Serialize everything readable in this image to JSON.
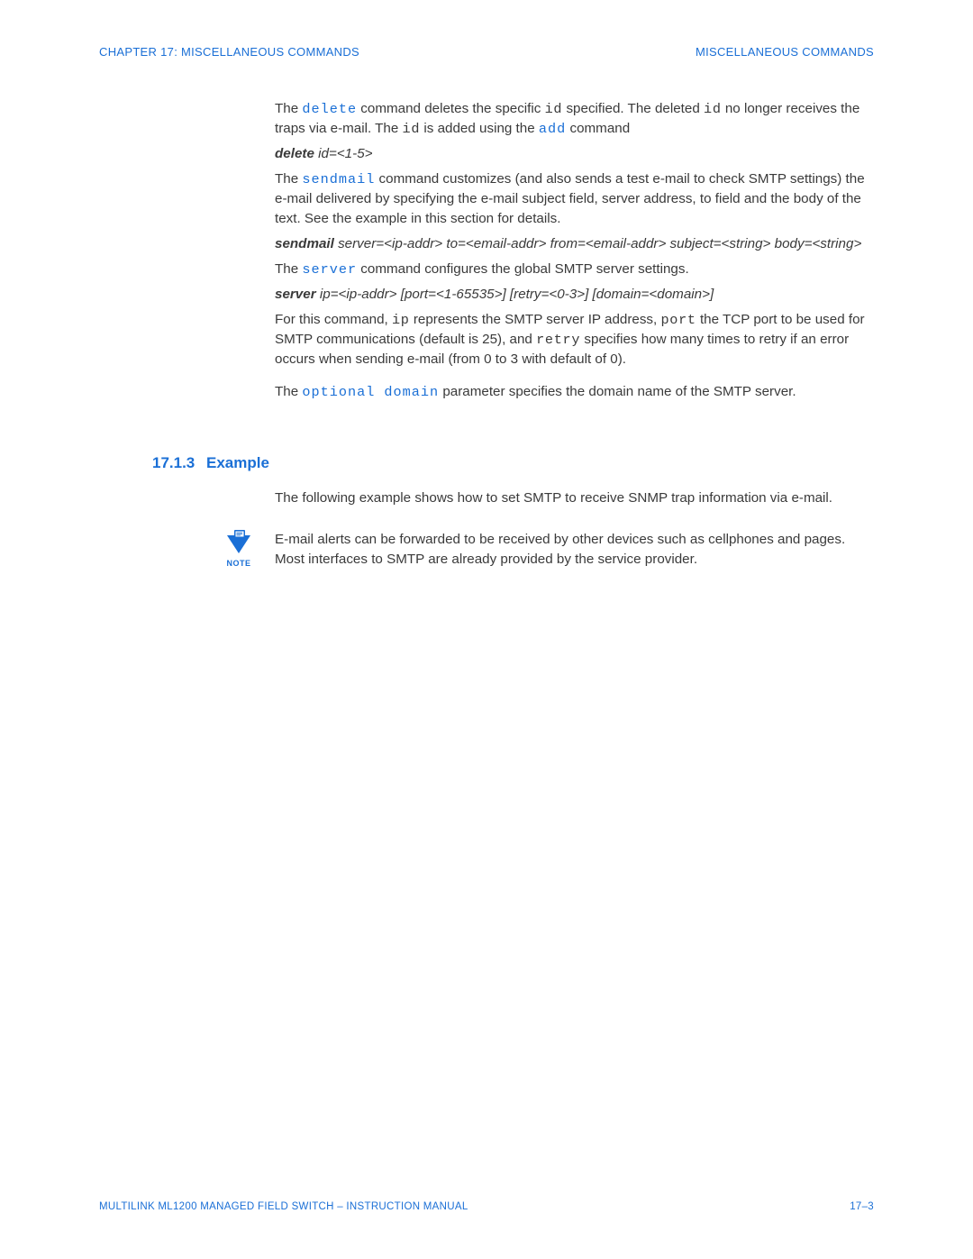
{
  "header": {
    "left": "CHAPTER 17:  MISCELLANEOUS COMMANDS",
    "right": "MISCELLANEOUS COMMANDS"
  },
  "para_delete": {
    "t1": "The ",
    "cmd": "delete",
    "t2": " command deletes the specific ",
    "id1": "id",
    "t3": " specified. The deleted ",
    "id2": "id",
    "t4": " no longer receives the traps via e-mail. The ",
    "id3": "id",
    "t5": " is added using the ",
    "add": "add",
    "t6": " command"
  },
  "syntax_delete": {
    "kw": "delete",
    "args": " id=<1-5>"
  },
  "para_sendmail": {
    "t1": "The ",
    "cmd": "sendmail",
    "t2": " command customizes (and also sends a test e-mail to check SMTP settings) the e-mail delivered by specifying the e-mail subject field, server address, to field and the body of the text. See the example in this section for details."
  },
  "syntax_sendmail": {
    "kw": "sendmail",
    "args": " server=<ip-addr> to=<email-addr> from=<email-addr> subject=<string> body=<string>"
  },
  "para_server": {
    "t1": "The ",
    "cmd": "server",
    "t2": " command configures the global SMTP server settings."
  },
  "syntax_server": {
    "kw": "server",
    "args": " ip=<ip-addr> [port=<1-65535>] [retry=<0-3>] [domain=<domain>]"
  },
  "para_port": {
    "t1": "For this command, ",
    "ip": "ip",
    "t2": " represents the SMTP server IP address, ",
    "port": "port",
    "t3": " the TCP port to be used for SMTP communications (default is 25), and ",
    "retry": "retry",
    "t4": " specifies how many times to retry if an error occurs when sending e-mail (from 0 to 3 with default of 0)."
  },
  "para_domain": {
    "t1": "The ",
    "cmd": "optional domain",
    "t2": " parameter specifies the domain name of the SMTP server."
  },
  "section": {
    "num": "17.1.3",
    "title": "Example"
  },
  "example_intro": "The following example shows how to set SMTP to receive SNMP trap information via e-mail.",
  "note": {
    "label": "NOTE",
    "text": "E-mail alerts can be forwarded to be received by other devices such as cellphones and pages. Most interfaces to SMTP are already provided by the service provider."
  },
  "footer": {
    "left": "MULTILINK ML1200 MANAGED FIELD SWITCH – INSTRUCTION MANUAL",
    "right": "17–3"
  }
}
